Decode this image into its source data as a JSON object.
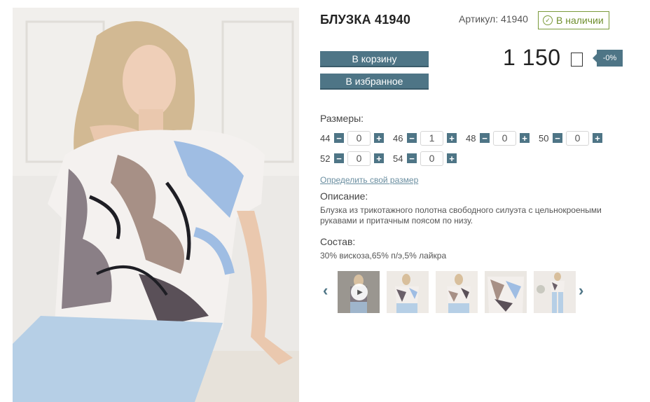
{
  "product": {
    "title": "БЛУЗКА 41940",
    "sku_text": "Артикул: 41940",
    "stock_text": "В наличии",
    "price": "1 150",
    "discount": "-0%"
  },
  "actions": {
    "cart_label": "В корзину",
    "favorite_label": "В избранное"
  },
  "sizes": {
    "label": "Размеры:",
    "items": [
      {
        "size": "44",
        "qty": "0"
      },
      {
        "size": "46",
        "qty": "1"
      },
      {
        "size": "48",
        "qty": "0"
      },
      {
        "size": "50",
        "qty": "0"
      },
      {
        "size": "52",
        "qty": "0"
      },
      {
        "size": "54",
        "qty": "0"
      }
    ],
    "minus": "−",
    "plus": "+"
  },
  "size_link": "Определить свой размер",
  "description": {
    "label": "Описание:",
    "text": "Блузка из трикотажного полотна свободного силуэта с цельнокроеными рукавами и притачным поясом по низу."
  },
  "composition": {
    "label": "Состав:",
    "text": "30% вискоза,65% п/э,5% лайкра"
  },
  "gallery": {
    "prev_icon": "chevron-left-icon",
    "next_icon": "chevron-right-icon",
    "prev_glyph": "‹",
    "next_glyph": "›",
    "play_icon": "play-icon"
  },
  "colors": {
    "accent": "#4e7586",
    "stock": "#7a9a3a"
  }
}
